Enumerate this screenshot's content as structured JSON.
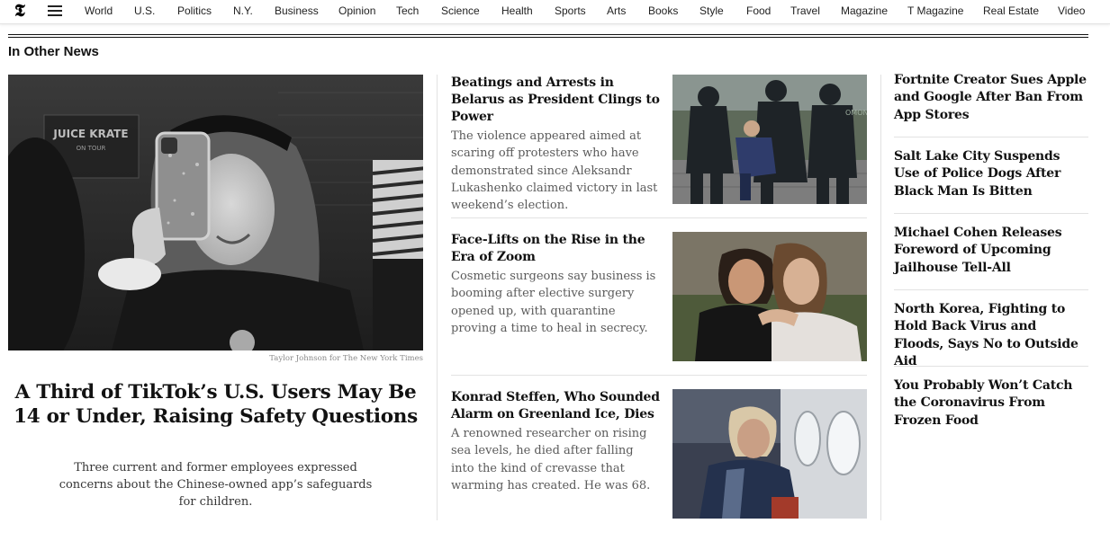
{
  "nav": {
    "logo_glyph": "𝕿",
    "links": [
      "World",
      "U.S.",
      "Politics",
      "N.Y.",
      "Business",
      "Opinion",
      "Tech",
      "Science",
      "Health",
      "Sports",
      "Arts",
      "Books",
      "Style",
      "Food",
      "Travel",
      "Magazine",
      "T Magazine",
      "Real Estate",
      "Video"
    ]
  },
  "section": {
    "title": "In Other News"
  },
  "lead": {
    "image_credit": "Taylor Johnson for The New York Times",
    "image_sign_text": "JUICE KRATE",
    "image_sign_subtext": "ON TOUR",
    "headline": "A Third of TikTok’s U.S. Users May Be 14 or Under, Raising Safety Questions",
    "summary": "Three current and former employees expressed concerns about the Chinese-owned app’s safeguards for children."
  },
  "middle": [
    {
      "headline": "Beatings and Arrests in Belarus as President Clings to Power",
      "summary": "The violence appeared aimed at scaring off protesters who have demonstrated since Aleksandr Lukashenko claimed victory in last weekend’s election."
    },
    {
      "headline": "Face-Lifts on the Rise in the Era of Zoom",
      "summary": "Cosmetic surgeons say business is booming after elective surgery opened up, with quarantine proving a time to heal in secrecy."
    },
    {
      "headline": "Konrad Steffen, Who Sounded Alarm on Greenland Ice, Dies",
      "summary": "A renowned researcher on rising sea levels, he died after falling into the kind of crevasse that warming has created. He was 68."
    }
  ],
  "right": [
    "Fortnite Creator Sues Apple and Google After Ban From App Stores",
    "Salt Lake City Suspends Use of Police Dogs After Black Man Is Bitten",
    "Michael Cohen Releases Foreword of Upcoming Jailhouse Tell-All",
    "North Korea, Fighting to Hold Back Virus and Floods, Says No to Outside Aid",
    "You Probably Won’t Catch the Coronavirus From Frozen Food"
  ],
  "colors": {
    "text": "#121212",
    "summary_gray": "#5a5a5a",
    "rule": "#e2e2e2",
    "credit_gray": "#8a8a8a"
  }
}
